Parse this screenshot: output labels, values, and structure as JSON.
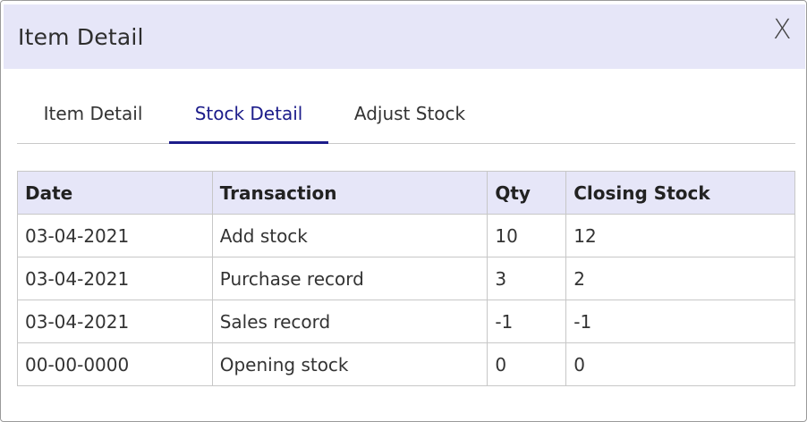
{
  "dialog": {
    "title": "Item Detail",
    "close_label": "X"
  },
  "tabs": [
    {
      "label": "Item Detail",
      "active": false
    },
    {
      "label": "Stock Detail",
      "active": true
    },
    {
      "label": "Adjust Stock",
      "active": false
    }
  ],
  "table": {
    "headers": [
      "Date",
      "Transaction",
      "Qty",
      "Closing Stock"
    ],
    "rows": [
      [
        "03-04-2021",
        "Add stock",
        "10",
        "12"
      ],
      [
        "03-04-2021",
        "Purchase record",
        "3",
        "2"
      ],
      [
        "03-04-2021",
        "Sales record",
        "-1",
        "-1"
      ],
      [
        "00-00-0000",
        "Opening stock",
        "0",
        "0"
      ]
    ]
  },
  "colors": {
    "header_bg": "#e6e6f8",
    "active_tab": "#1c1c8a",
    "border": "#c7c7c7"
  }
}
